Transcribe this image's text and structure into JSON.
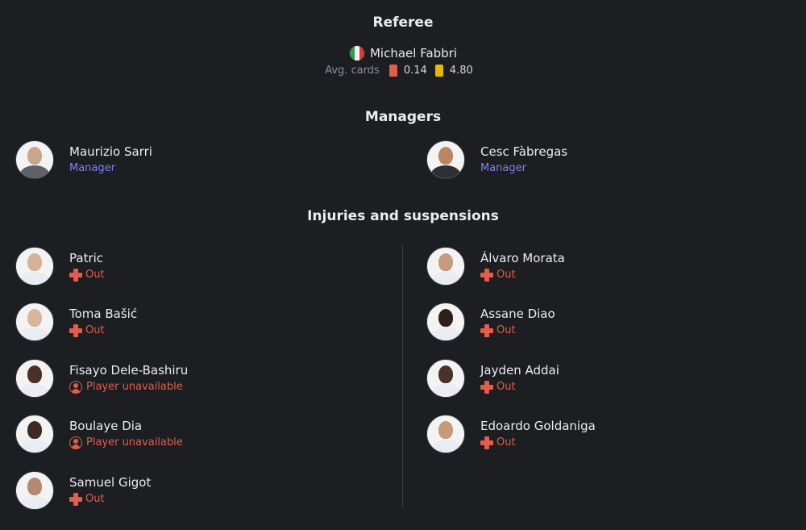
{
  "referee": {
    "title": "Referee",
    "name": "Michael Fabbri",
    "flag_icon": "italy-flag-icon",
    "avg_cards_label": "Avg. cards",
    "red_avg": "0.14",
    "yellow_avg": "4.80",
    "colors": {
      "red_card": "#e35d4a",
      "yellow_card": "#e6b800"
    }
  },
  "managers": {
    "title": "Managers",
    "home": {
      "name": "Maurizio Sarri",
      "role": "Manager"
    },
    "away": {
      "name": "Cesc Fàbregas",
      "role": "Manager"
    }
  },
  "injuries": {
    "title": "Injuries and suspensions",
    "home": [
      {
        "name": "Patric",
        "status": "Out",
        "icon": "cross-icon"
      },
      {
        "name": "Toma Bašić",
        "status": "Out",
        "icon": "cross-icon"
      },
      {
        "name": "Fisayo Dele-Bashiru",
        "status": "Player unavailable",
        "icon": "person-unavailable-icon"
      },
      {
        "name": "Boulaye Dia",
        "status": "Player unavailable",
        "icon": "person-unavailable-icon"
      },
      {
        "name": "Samuel Gigot",
        "status": "Out",
        "icon": "cross-icon"
      }
    ],
    "away": [
      {
        "name": "Álvaro Morata",
        "status": "Out",
        "icon": "cross-icon"
      },
      {
        "name": "Assane Diao",
        "status": "Out",
        "icon": "cross-icon"
      },
      {
        "name": "Jayden Addai",
        "status": "Out",
        "icon": "cross-icon"
      },
      {
        "name": "Edoardo Goldaniga",
        "status": "Out",
        "icon": "cross-icon"
      }
    ]
  },
  "colors": {
    "status_red": "#e35d4a",
    "manager_role": "#7b84f0",
    "background": "#1c1e21"
  }
}
